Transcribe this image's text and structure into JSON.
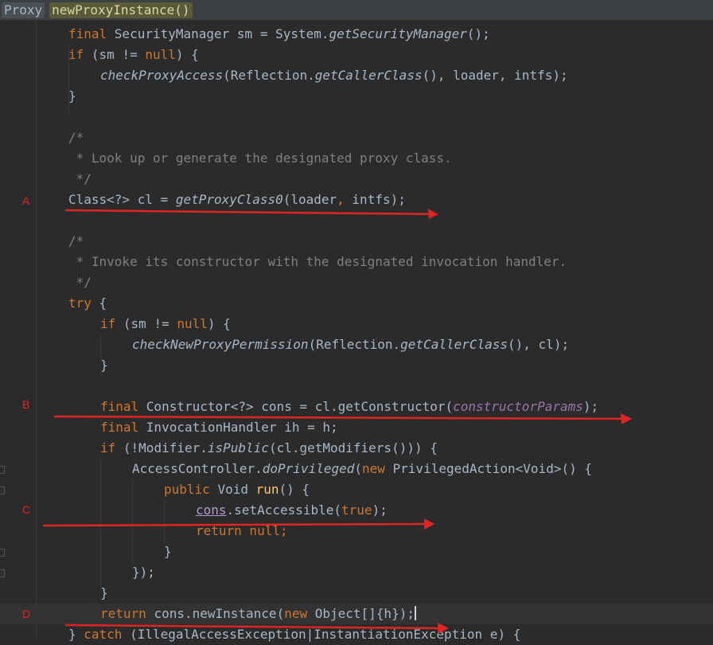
{
  "breadcrumb": {
    "class_name": "Proxy",
    "method_name": "newProxyInstance()"
  },
  "markers": {
    "a": "A",
    "b": "B",
    "c": "C",
    "d": "D"
  },
  "code": {
    "l1": {
      "p1": "final ",
      "p2": "SecurityManager sm = System.",
      "p3": "getSecurityManager",
      "p4": "();"
    },
    "l2": {
      "p1": "if ",
      "p2": "(sm != ",
      "p3": "null",
      "p4": ") {"
    },
    "l3": {
      "p1": "checkProxyAccess",
      "p2": "(Reflection.",
      "p3": "getCallerClass",
      "p4": "(), loader, intfs);"
    },
    "l4": {
      "p1": "}"
    },
    "l6": {
      "p1": "/*"
    },
    "l7": {
      "p1": " * Look up or generate the designated proxy class."
    },
    "l8": {
      "p1": " */"
    },
    "l9": {
      "p1": "Class<?> cl = ",
      "p2": "getProxyClass0",
      "p3": "(loader",
      "p4": ", ",
      "p5": "intfs);"
    },
    "l11": {
      "p1": "/*"
    },
    "l12": {
      "p1": " * Invoke its constructor with the designated invocation handler."
    },
    "l13": {
      "p1": " */"
    },
    "l14": {
      "p1": "try ",
      "p2": "{"
    },
    "l15": {
      "p1": "if ",
      "p2": "(sm != ",
      "p3": "null",
      "p4": ") {"
    },
    "l16": {
      "p1": "checkNewProxyPermission",
      "p2": "(Reflection.",
      "p3": "getCallerClass",
      "p4": "(), cl);"
    },
    "l17": {
      "p1": "}"
    },
    "l19": {
      "p1": "final ",
      "p2": "Constructor<?> cons = cl.getConstructor(",
      "p3": "constructorParams",
      "p4": ");"
    },
    "l20": {
      "p1": "final ",
      "p2": "InvocationHandler ih = h;"
    },
    "l21": {
      "p1": "if ",
      "p2": "(!Modifier.",
      "p3": "isPublic",
      "p4": "(cl.getModifiers())) {"
    },
    "l22": {
      "p1": "AccessController.",
      "p2": "doPrivileged",
      "p3": "(",
      "p4": "new ",
      "p5": "PrivilegedAction<Void>() {"
    },
    "l23": {
      "p1": "public ",
      "p2": "Void ",
      "p3": "run",
      "p4": "() {"
    },
    "l24": {
      "p1": "cons",
      "p2": ".setAccessible(",
      "p3": "true",
      "p4": ");"
    },
    "l25": {
      "p1": "return null",
      "p2": ";"
    },
    "l26": {
      "p1": "}"
    },
    "l27": {
      "p1": "});"
    },
    "l28": {
      "p1": "}"
    },
    "l29": {
      "p1": "return ",
      "p2": "cons.newInstance(",
      "p3": "new ",
      "p4": "Object[]{h});"
    },
    "l30": {
      "p1": "} ",
      "p2": "catch ",
      "p3": "(IllegalAccessException|InstantiationException e) {"
    }
  },
  "colors": {
    "annotation": "#e02424",
    "keyword": "#cc7832",
    "method": "#ffc66d",
    "field": "#9876aa",
    "comment": "#808080"
  }
}
